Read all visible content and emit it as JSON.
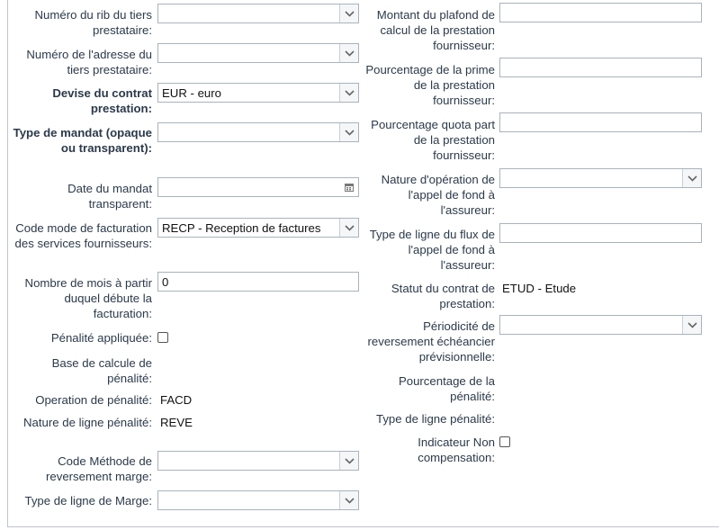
{
  "left": {
    "rib_label": "Numéro du rib du tiers prestataire:",
    "adresse_label": "Numéro de l'adresse du tiers prestataire:",
    "devise_label": "Devise du contrat prestation:",
    "devise_value": "EUR - euro",
    "mandat_type_label": "Type de mandat (opaque ou transparent):",
    "mandat_date_label": "Date du mandat transparent:",
    "code_mode_label": "Code mode de facturation des services fournisseurs:",
    "code_mode_value": "RECP - Reception de factures",
    "nb_mois_label": "Nombre de mois à partir duquel débute la facturation:",
    "nb_mois_value": "0",
    "penalite_label": "Pénalité appliquée:",
    "base_calcul_label": "Base de calcule de pénalité:",
    "operation_label": "Operation de pénalité:",
    "operation_value": "FACD",
    "nature_ligne_label": "Nature de ligne pénalité:",
    "nature_ligne_value": "REVE",
    "code_methode_label": "Code Méthode de reversement marge:",
    "type_marge_label": "Type de ligne de Marge:"
  },
  "right": {
    "plafond_label": "Montant du plafond de calcul de la prestation fournisseur:",
    "prime_label": "Pourcentage de la prime de la prestation fournisseur:",
    "quota_label": "Pourcentage quota part de la prestation fournisseur:",
    "nature_op_label": "Nature d'opération de l'appel de fond à l'assureur:",
    "type_flux_label": "Type de ligne du flux de l'appel de fond à l'assureur:",
    "statut_label": "Statut du contrat de prestation:",
    "statut_value": "ETUD - Etude",
    "periodicite_label": "Périodicité de reversement échéancier prévisionnelle:",
    "pct_penalite_label": "Pourcentage de la pénalité:",
    "type_penalite_label": "Type de ligne pénalité:",
    "indicateur_label": "Indicateur Non compensation:"
  },
  "icons": {
    "dropdown": "chevron-down-icon",
    "calendar": "calendar-icon"
  }
}
